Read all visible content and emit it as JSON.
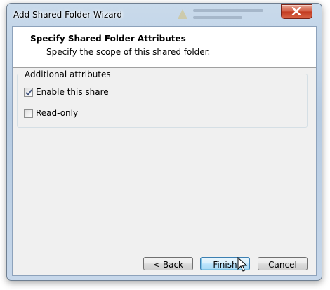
{
  "window": {
    "title": "Add Shared Folder Wizard"
  },
  "header": {
    "title": "Specify Shared Folder Attributes",
    "subtitle": "Specify the scope of this shared folder."
  },
  "attributes": {
    "group_label": "Additional attributes",
    "enable_share": {
      "label": "Enable this share",
      "checked": true
    },
    "read_only": {
      "label": "Read-only",
      "checked": false
    }
  },
  "buttons": {
    "back": "< Back",
    "finish": "Finish",
    "cancel": "Cancel"
  },
  "icons": {
    "close": "close-icon",
    "check": "checkmark-icon",
    "cursor": "mouse-pointer-icon"
  },
  "colors": {
    "accent": "#3c7fb1",
    "close_button": "#c23a20",
    "titlebar": "#b6cbe2"
  }
}
